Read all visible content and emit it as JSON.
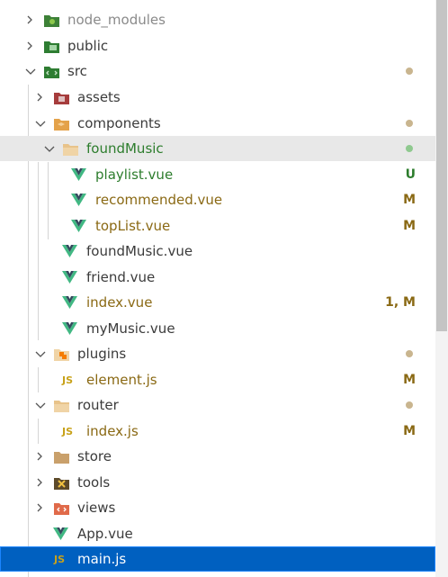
{
  "explorer": {
    "items": [
      {
        "label": "node_modules"
      },
      {
        "label": "public"
      },
      {
        "label": "src"
      },
      {
        "label": "assets"
      },
      {
        "label": "components"
      },
      {
        "label": "foundMusic"
      },
      {
        "label": "playlist.vue",
        "status": "U"
      },
      {
        "label": "recommended.vue",
        "status": "M"
      },
      {
        "label": "topList.vue",
        "status": "M"
      },
      {
        "label": "foundMusic.vue"
      },
      {
        "label": "friend.vue"
      },
      {
        "label": "index.vue",
        "status": "1, M"
      },
      {
        "label": "myMusic.vue"
      },
      {
        "label": "plugins"
      },
      {
        "label": "element.js",
        "status": "M"
      },
      {
        "label": "router"
      },
      {
        "label": "index.js",
        "status": "M"
      },
      {
        "label": "store"
      },
      {
        "label": "tools"
      },
      {
        "label": "views"
      },
      {
        "label": "App.vue"
      },
      {
        "label": "main.js"
      }
    ],
    "js_badge": "JS"
  },
  "colors": {
    "selected_row": "#0060c0",
    "git_added": "#2d7d2d",
    "git_modified": "#8a6914",
    "vue_green": "#41b883",
    "vue_dark": "#35495e"
  }
}
